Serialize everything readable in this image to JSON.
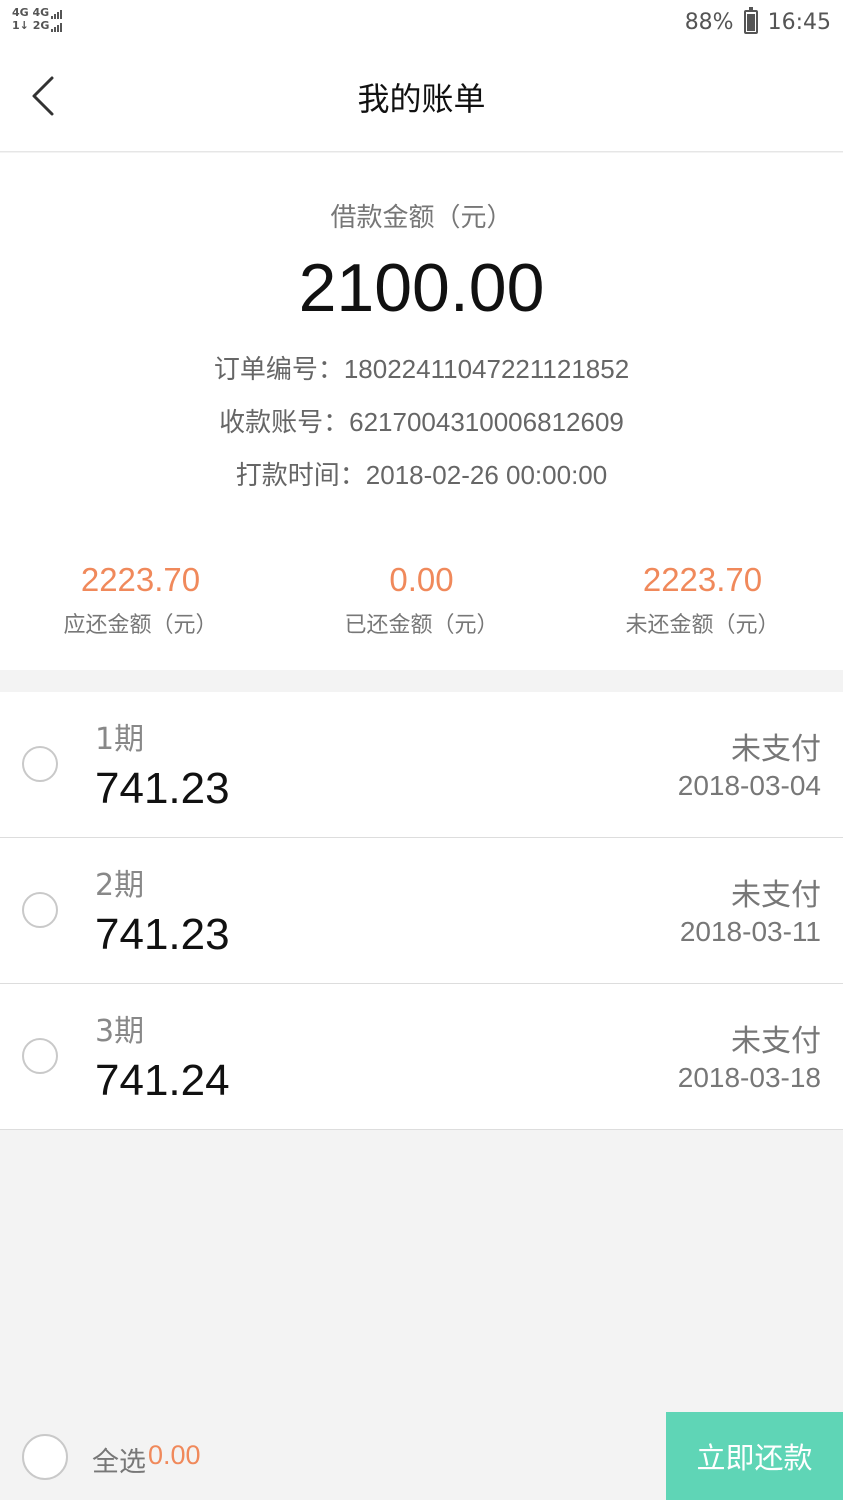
{
  "status_bar": {
    "network_line1": "4G 4G",
    "network_line2": "1↓ 2G",
    "battery": "88%",
    "time": "16:45"
  },
  "nav": {
    "title": "我的账单",
    "back_icon": "chevron-left-icon"
  },
  "summary": {
    "loan_label": "借款金额（元）",
    "loan_amount": "2100.00",
    "order_label": "订单编号：",
    "order_no": "18022411047221121852",
    "account_label": "收款账号：",
    "account_no": "6217004310006812609",
    "time_label": "打款时间：",
    "pay_time": "2018-02-26 00:00:00"
  },
  "stats": [
    {
      "value": "2223.70",
      "label": "应还金额（元）"
    },
    {
      "value": "0.00",
      "label": "已还金额（元）"
    },
    {
      "value": "2223.70",
      "label": "未还金额（元）"
    }
  ],
  "installments": [
    {
      "period": "1期",
      "amount": "741.23",
      "status": "未支付",
      "date": "2018-03-04"
    },
    {
      "period": "2期",
      "amount": "741.23",
      "status": "未支付",
      "date": "2018-03-11"
    },
    {
      "period": "3期",
      "amount": "741.24",
      "status": "未支付",
      "date": "2018-03-18"
    }
  ],
  "footer": {
    "select_all_label": "全选",
    "total": "0.00",
    "pay_button": "立即还款"
  },
  "colors": {
    "accent_orange": "#f0895b",
    "button_green": "#5fd5b6"
  }
}
